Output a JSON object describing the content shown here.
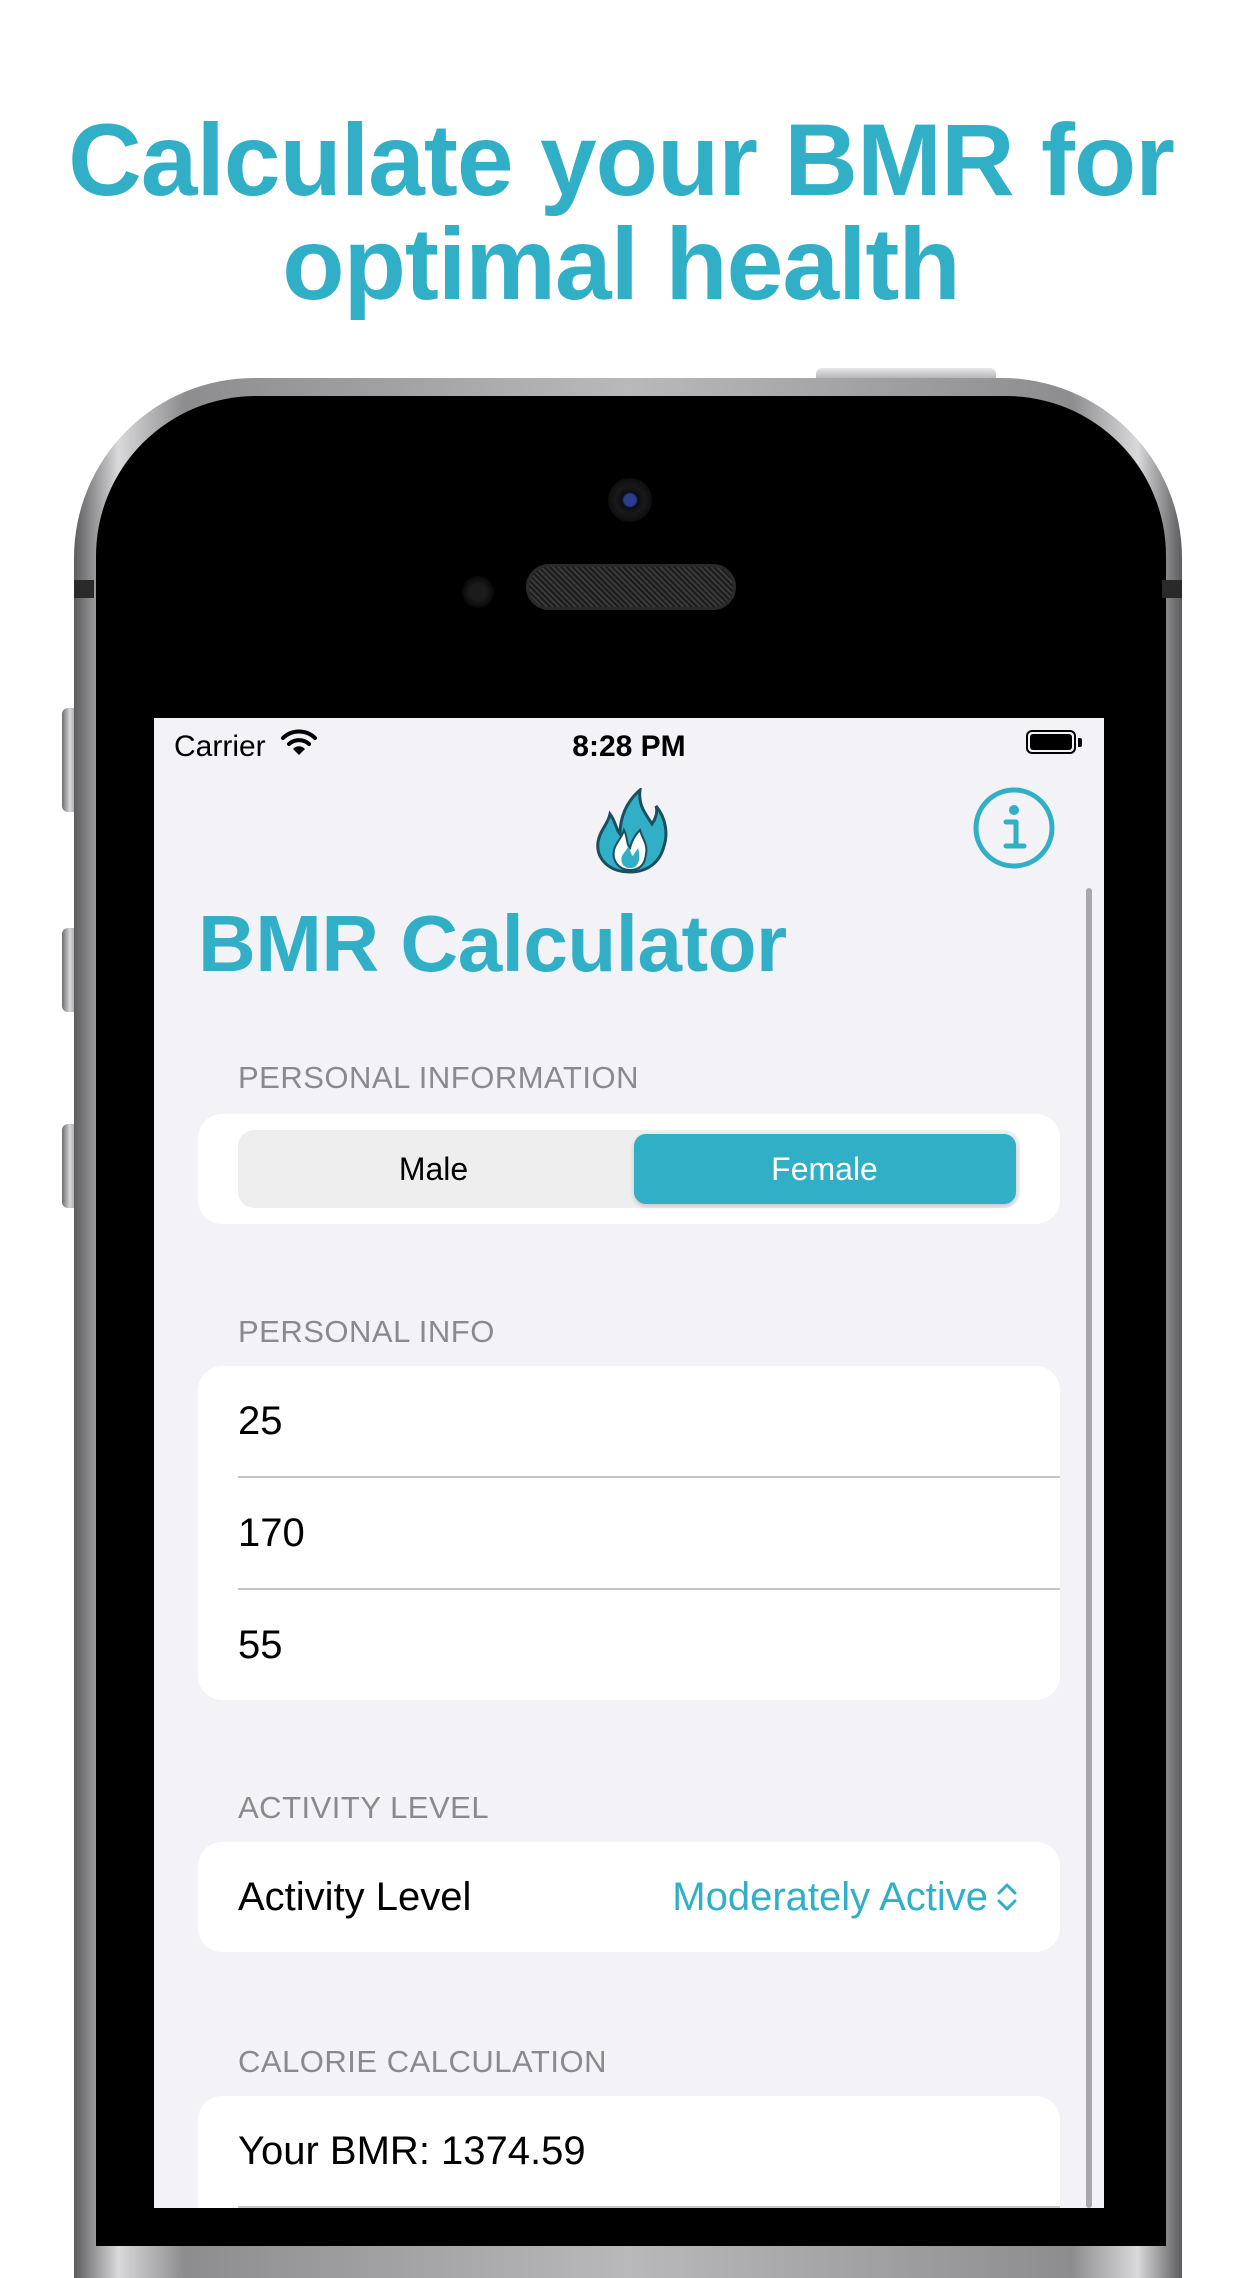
{
  "headline": {
    "line1": "Calculate your BMR for",
    "line2": "optimal health"
  },
  "status_bar": {
    "carrier": "Carrier",
    "time": "8:28 PM"
  },
  "nav": {
    "logo_icon": "flame-icon",
    "info_icon": "info-circle-icon"
  },
  "title": "BMR Calculator",
  "sections": {
    "personal_information": {
      "header": "PERSONAL INFORMATION",
      "options": [
        "Male",
        "Female"
      ],
      "selected": "Female"
    },
    "personal_info": {
      "header": "PERSONAL INFO",
      "values": [
        "25",
        "170",
        "55"
      ]
    },
    "activity_level": {
      "header": "ACTIVITY LEVEL",
      "label": "Activity Level",
      "value": "Moderately Active"
    },
    "calorie_calculation": {
      "header": "CALORIE CALCULATION",
      "bmr_text": "Your BMR: 1374.59"
    }
  },
  "colors": {
    "accent": "#31afc6",
    "background": "#f2f2f7",
    "section_header": "#8a8a8e"
  }
}
